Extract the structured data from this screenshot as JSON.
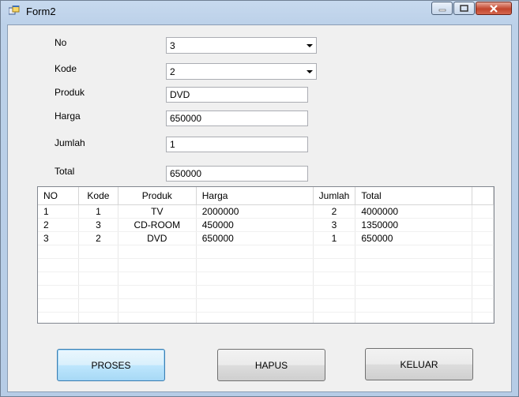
{
  "window": {
    "title": "Form2"
  },
  "form": {
    "no_label": "No",
    "no_value": "3",
    "kode_label": "Kode",
    "kode_value": "2",
    "produk_label": "Produk",
    "produk_value": "DVD",
    "harga_label": "Harga",
    "harga_value": "650000",
    "jumlah_label": "Jumlah",
    "jumlah_value": "1",
    "total_label": "Total",
    "total_value": "650000"
  },
  "grid": {
    "columns": [
      "NO",
      "Kode",
      "Produk",
      "Harga",
      "Jumlah",
      "Total"
    ],
    "rows": [
      [
        "1",
        "1",
        "TV",
        "2000000",
        "2",
        "4000000"
      ],
      [
        "2",
        "3",
        "CD-ROOM",
        "450000",
        "3",
        "1350000"
      ],
      [
        "3",
        "2",
        "DVD",
        "650000",
        "1",
        "650000"
      ]
    ]
  },
  "buttons": {
    "proses": "PROSES",
    "hapus": "HAPUS",
    "keluar": "KELUAR"
  },
  "colors": {
    "close_button": "#c2452c",
    "focus_border": "#3c7fb1"
  }
}
